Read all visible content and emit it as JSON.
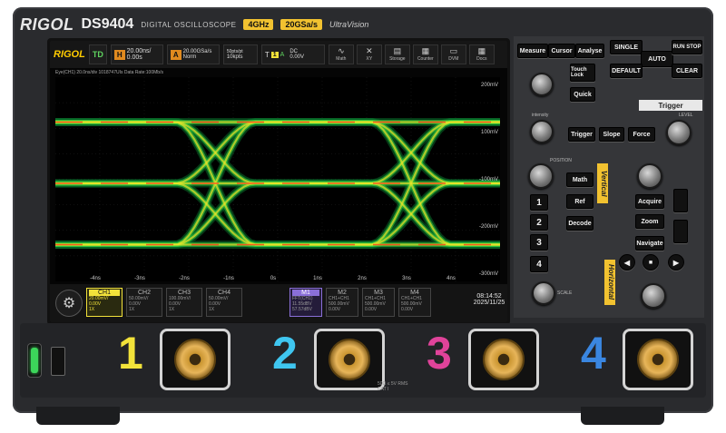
{
  "header": {
    "logo": "RIGOL",
    "model": "DS9404",
    "product_type": "DIGITAL OSCILLOSCOPE",
    "bandwidth": "4GHz",
    "sample_rate": "20GSa/s",
    "series": "UltraVision"
  },
  "screen": {
    "top": {
      "logo": "RIGOL",
      "mode": "TD",
      "horizontal_label": "H",
      "timebase": "20.00ns/",
      "offset": "0.00s",
      "acquire_label": "A",
      "sample": "20.00GSa/s",
      "acq_mode": "Norm",
      "points_top": "50pts/pt",
      "memory": "10kpts",
      "trigger_icon": "T",
      "trigger_ch": "1",
      "trigger_mode": "A",
      "trigger_coupling": "DC",
      "trigger_level": "0.00V",
      "tools": [
        {
          "label": "Math",
          "icon": "∿"
        },
        {
          "label": "XY",
          "icon": "✕"
        },
        {
          "label": "Storage",
          "icon": "▤"
        },
        {
          "label": "Counter",
          "icon": "▦"
        },
        {
          "label": "DVM",
          "icon": "▭"
        },
        {
          "label": "Docs",
          "icon": "▦"
        }
      ]
    },
    "info_line": "Eye(CH1)   20.0ns/div   1018747UIs   Data Rate:100Mb/s",
    "y_labels": [
      "200mV",
      "100mV",
      "-100mV",
      "-200mV",
      "-300mV"
    ],
    "x_labels": [
      "-4ns",
      "-3ns",
      "-2ns",
      "-1ns",
      "0s",
      "1ns",
      "2ns",
      "3ns",
      "4ns"
    ],
    "channels": [
      {
        "name": "CH1",
        "scale": "20.00mV/",
        "offset": "0.00V",
        "probe": "1X",
        "active": true
      },
      {
        "name": "CH2",
        "scale": "50.00mV/",
        "offset": "0.00V",
        "probe": "1X",
        "active": false
      },
      {
        "name": "CH3",
        "scale": "100.00mV/",
        "offset": "0.00V",
        "probe": "1X",
        "active": false
      },
      {
        "name": "CH4",
        "scale": "50.00mV/",
        "offset": "0.00V",
        "probe": "1X",
        "active": false
      }
    ],
    "math": [
      {
        "name": "M1",
        "src": "FFT(CH1)",
        "v1": "11.55dBV",
        "v2": "57.57dBV",
        "active": true
      },
      {
        "name": "M2",
        "src": "CH1+CH1",
        "v1": "500.00mV",
        "v2": "0.00V",
        "active": false
      },
      {
        "name": "M3",
        "src": "CH1+CH1",
        "v1": "500.00mV",
        "v2": "0.00V",
        "active": false
      },
      {
        "name": "M4",
        "src": "CH1+CH1",
        "v1": "500.00mV",
        "v2": "0.00V",
        "active": false
      }
    ],
    "clock": "08:14:52",
    "date": "2025/11/25"
  },
  "panel": {
    "menu_buttons": [
      "Measure",
      "Cursor",
      "Analyse"
    ],
    "quick_buttons": [
      "SINGLE",
      "AUTO",
      "RUN STOP",
      "DEFAULT",
      "CLEAR"
    ],
    "touch_lock": "Touch Lock",
    "quick": "Quick",
    "trigger_title": "Trigger",
    "trigger_buttons": [
      "Trigger",
      "Slope",
      "Force"
    ],
    "vertical_title": "Vertical",
    "horizontal_title": "Horizontal",
    "vertical_buttons": [
      "Math",
      "Ref",
      "Decode"
    ],
    "channel_buttons": [
      "1",
      "2",
      "3",
      "4"
    ],
    "horizontal_buttons": [
      "Acquire",
      "Zoom",
      "Navigate"
    ],
    "knob_labels": {
      "intensity": "intensity",
      "level": "LEVEL",
      "position": "POSITION",
      "scale": "SCALE"
    }
  },
  "front": {
    "channels": [
      "1",
      "2",
      "3",
      "4"
    ],
    "channel_colors": [
      "#f2e23a",
      "#3fc6f0",
      "#e0439a",
      "#3a86e0"
    ],
    "warning": "50Ω ≤ 5V RMS",
    "warning2": "CAT I"
  },
  "colors": {
    "accent": "#f2c230",
    "ch1": "#f2e23a"
  }
}
